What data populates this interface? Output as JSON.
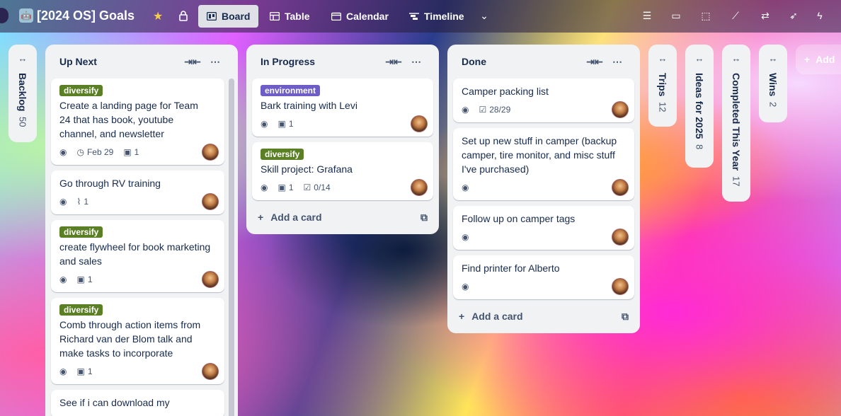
{
  "board": {
    "title": "[2024 OS] Goals",
    "emoji": "🤖"
  },
  "views": [
    {
      "label": "Board",
      "icon": "board-icon",
      "active": true
    },
    {
      "label": "Table",
      "icon": "table-icon",
      "active": false
    },
    {
      "label": "Calendar",
      "icon": "calendar-icon",
      "active": false
    },
    {
      "label": "Timeline",
      "icon": "timeline-icon",
      "active": false
    }
  ],
  "label_colors": {
    "diversify": "#5b7f24",
    "environment": "#6e5dc6"
  },
  "lists": {
    "up_next": {
      "title": "Up Next",
      "cards": [
        {
          "label": "diversify",
          "title": "Create a landing page for Team 24 that has book, youtube channel, and newsletter",
          "date": "Feb 29",
          "checklist_count": "1"
        },
        {
          "title": "Go through RV training",
          "attachments": "1"
        },
        {
          "label": "diversify",
          "title": "create flywheel for book marketing and sales",
          "checklist_count": "1"
        },
        {
          "label": "diversify",
          "title": "Comb through action items from Richard van der Blom talk and make tasks to incorporate",
          "checklist_count": "1"
        },
        {
          "title": "See if i can download my"
        }
      ]
    },
    "in_progress": {
      "title": "In Progress",
      "cards": [
        {
          "label": "environment",
          "title": "Bark training with Levi",
          "checklist_count": "1"
        },
        {
          "label": "diversify",
          "title": "Skill project: Grafana",
          "checklist_count": "1",
          "checklist": "0/14"
        }
      ],
      "add_card": "Add a card"
    },
    "done": {
      "title": "Done",
      "cards": [
        {
          "title": "Camper packing list",
          "checklist": "28/29"
        },
        {
          "title": "Set up new stuff in camper (backup camper, tire monitor, and misc stuff I've purchased)"
        },
        {
          "title": "Follow up on camper tags"
        },
        {
          "title": "Find printer for Alberto"
        }
      ],
      "add_card": "Add a card"
    }
  },
  "collapsed_lists": [
    {
      "name": "Backlog",
      "count": "50"
    },
    {
      "name": "Trips",
      "count": "12"
    },
    {
      "name": "Ideas for 2025",
      "count": "8"
    },
    {
      "name": "Completed This Year",
      "count": "17"
    },
    {
      "name": "Wins",
      "count": "2"
    }
  ],
  "add_list": "Add"
}
